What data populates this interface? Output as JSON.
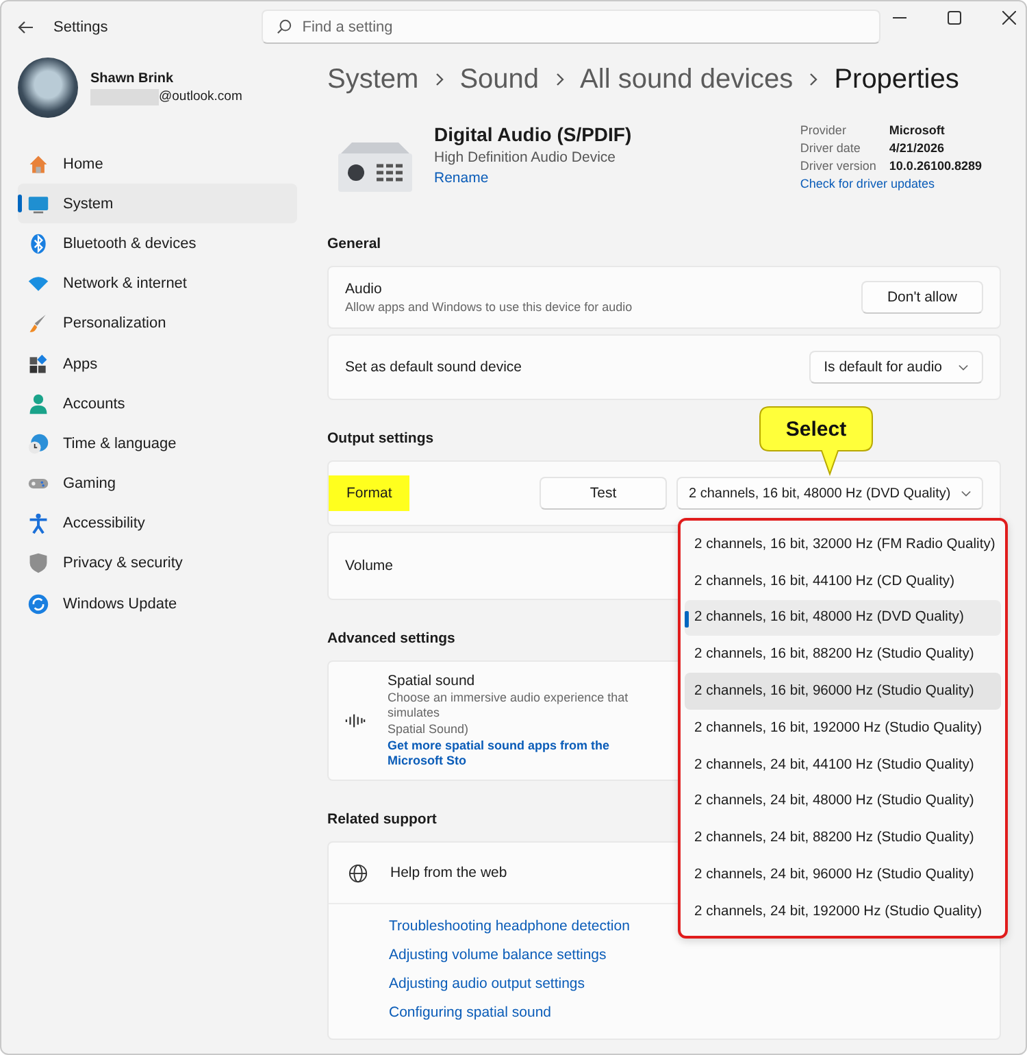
{
  "window": {
    "title": "Settings"
  },
  "search": {
    "placeholder": "Find a setting"
  },
  "profile": {
    "name": "Shawn Brink",
    "email": "@outlook.com"
  },
  "sidebar": {
    "items": [
      {
        "label": "Home",
        "selected": false
      },
      {
        "label": "System",
        "selected": true
      },
      {
        "label": "Bluetooth & devices",
        "selected": false
      },
      {
        "label": "Network & internet",
        "selected": false
      },
      {
        "label": "Personalization",
        "selected": false
      },
      {
        "label": "Apps",
        "selected": false
      },
      {
        "label": "Accounts",
        "selected": false
      },
      {
        "label": "Time & language",
        "selected": false
      },
      {
        "label": "Gaming",
        "selected": false
      },
      {
        "label": "Accessibility",
        "selected": false
      },
      {
        "label": "Privacy & security",
        "selected": false
      },
      {
        "label": "Windows Update",
        "selected": false
      }
    ]
  },
  "breadcrumb": [
    "System",
    "Sound",
    "All sound devices",
    "Properties"
  ],
  "device": {
    "name": "Digital Audio (S/PDIF)",
    "description": "High Definition Audio Device",
    "rename_link": "Rename",
    "info": [
      {
        "label": "Provider",
        "value": "Microsoft"
      },
      {
        "label": "Driver date",
        "value": "4/21/2026"
      },
      {
        "label": "Driver version",
        "value": "10.0.26100.8289"
      }
    ],
    "update_link": "Check for driver updates"
  },
  "sections": [
    {
      "heading": "General",
      "rows": [
        {
          "kind": "button",
          "title": "Audio",
          "description": "Allow apps and Windows to use this device for audio",
          "button": "Don't allow"
        },
        {
          "kind": "dropdown",
          "title": "Set as default sound device",
          "value": "Is default for audio"
        }
      ]
    },
    {
      "heading": "Output settings",
      "rows": [
        {
          "kind": "format",
          "title": "Format",
          "highlighted": true,
          "button": "Test",
          "value": "2 channels, 16 bit, 48000 Hz (DVD Quality)"
        },
        {
          "kind": "plain",
          "title": "Volume"
        }
      ]
    },
    {
      "heading": "Advanced settings",
      "rows": [
        {
          "kind": "spatial",
          "title": "Spatial sound",
          "description_lines": [
            "Choose an immersive audio experience that simulates",
            "Spatial Sound)"
          ],
          "link": "Get more spatial sound apps from the Microsoft Sto"
        }
      ]
    },
    {
      "heading": "Related support",
      "rows": [
        {
          "kind": "help",
          "title": "Help from the web",
          "links": [
            "Troubleshooting headphone detection",
            "Adjusting volume balance settings",
            "Adjusting audio output settings",
            "Configuring spatial sound"
          ]
        }
      ]
    }
  ],
  "format_menu": {
    "options": [
      {
        "label": "2 channels, 16 bit, 32000 Hz (FM Radio Quality)",
        "selected": false,
        "hovered": false
      },
      {
        "label": "2 channels, 16 bit, 44100 Hz (CD Quality)",
        "selected": false,
        "hovered": false
      },
      {
        "label": "2 channels, 16 bit, 48000 Hz (DVD Quality)",
        "selected": true,
        "hovered": false
      },
      {
        "label": "2 channels, 16 bit, 88200 Hz (Studio Quality)",
        "selected": false,
        "hovered": false
      },
      {
        "label": "2 channels, 16 bit, 96000 Hz (Studio Quality)",
        "selected": false,
        "hovered": true
      },
      {
        "label": "2 channels, 16 bit, 192000 Hz (Studio Quality)",
        "selected": false,
        "hovered": false
      },
      {
        "label": "2 channels, 24 bit, 44100 Hz (Studio Quality)",
        "selected": false,
        "hovered": false
      },
      {
        "label": "2 channels, 24 bit, 48000 Hz (Studio Quality)",
        "selected": false,
        "hovered": false
      },
      {
        "label": "2 channels, 24 bit, 88200 Hz (Studio Quality)",
        "selected": false,
        "hovered": false
      },
      {
        "label": "2 channels, 24 bit, 96000 Hz (Studio Quality)",
        "selected": false,
        "hovered": false
      },
      {
        "label": "2 channels, 24 bit, 192000 Hz (Studio Quality)",
        "selected": false,
        "hovered": false
      }
    ]
  },
  "callout": {
    "text": "Select"
  }
}
